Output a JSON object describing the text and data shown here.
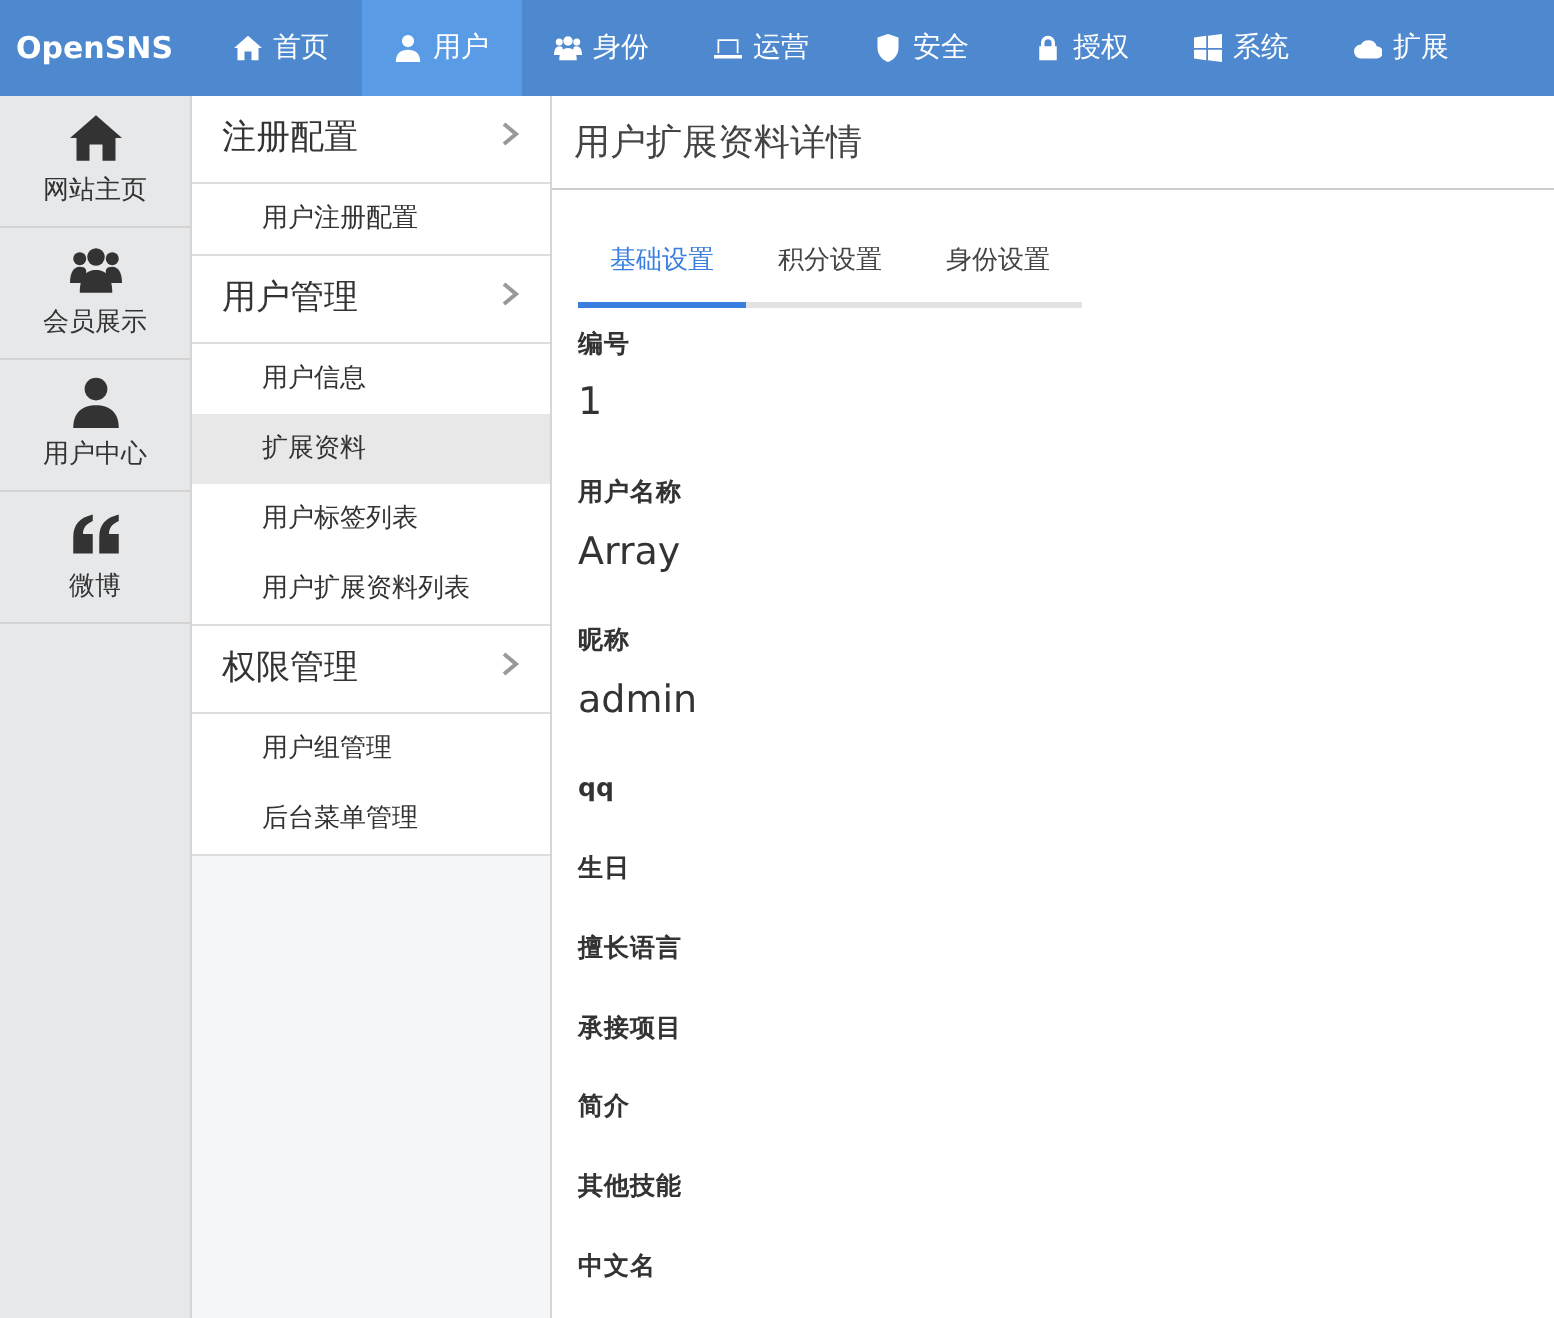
{
  "brand": "OpenSNS",
  "nav": [
    {
      "label": "首页",
      "kind": "home",
      "selected": false
    },
    {
      "label": "用户",
      "kind": "user",
      "selected": true
    },
    {
      "label": "身份",
      "kind": "users",
      "selected": false
    },
    {
      "label": "运营",
      "kind": "laptop",
      "selected": false
    },
    {
      "label": "安全",
      "kind": "shield",
      "selected": false
    },
    {
      "label": "授权",
      "kind": "lock",
      "selected": false
    },
    {
      "label": "系统",
      "kind": "windows",
      "selected": false
    },
    {
      "label": "扩展",
      "kind": "cloud",
      "selected": false
    }
  ],
  "rail": [
    {
      "label": "网站主页",
      "kind": "home"
    },
    {
      "label": "会员展示",
      "kind": "users"
    },
    {
      "label": "用户中心",
      "kind": "user"
    },
    {
      "label": "微博",
      "kind": "quote"
    }
  ],
  "sections": [
    {
      "title": "注册配置",
      "items": [
        {
          "label": "用户注册配置",
          "selected": false
        }
      ]
    },
    {
      "title": "用户管理",
      "items": [
        {
          "label": "用户信息",
          "selected": false
        },
        {
          "label": "扩展资料",
          "selected": true
        },
        {
          "label": "用户标签列表",
          "selected": false
        },
        {
          "label": "用户扩展资料列表",
          "selected": false
        }
      ]
    },
    {
      "title": "权限管理",
      "items": [
        {
          "label": "用户组管理",
          "selected": false
        },
        {
          "label": "后台菜单管理",
          "selected": false
        }
      ]
    }
  ],
  "page_title": "用户扩展资料详情",
  "tabs": [
    {
      "label": "基础设置",
      "selected": true
    },
    {
      "label": "积分设置",
      "selected": false
    },
    {
      "label": "身份设置",
      "selected": false
    }
  ],
  "fields": [
    {
      "label": "编号",
      "value": "1"
    },
    {
      "label": "用户名称",
      "value": "Array"
    },
    {
      "label": "昵称",
      "value": "admin"
    },
    {
      "label": "qq"
    },
    {
      "label": "生日"
    },
    {
      "label": "擅长语言"
    },
    {
      "label": "承接项目"
    },
    {
      "label": "简介"
    },
    {
      "label": "其他技能"
    },
    {
      "label": "中文名"
    }
  ]
}
